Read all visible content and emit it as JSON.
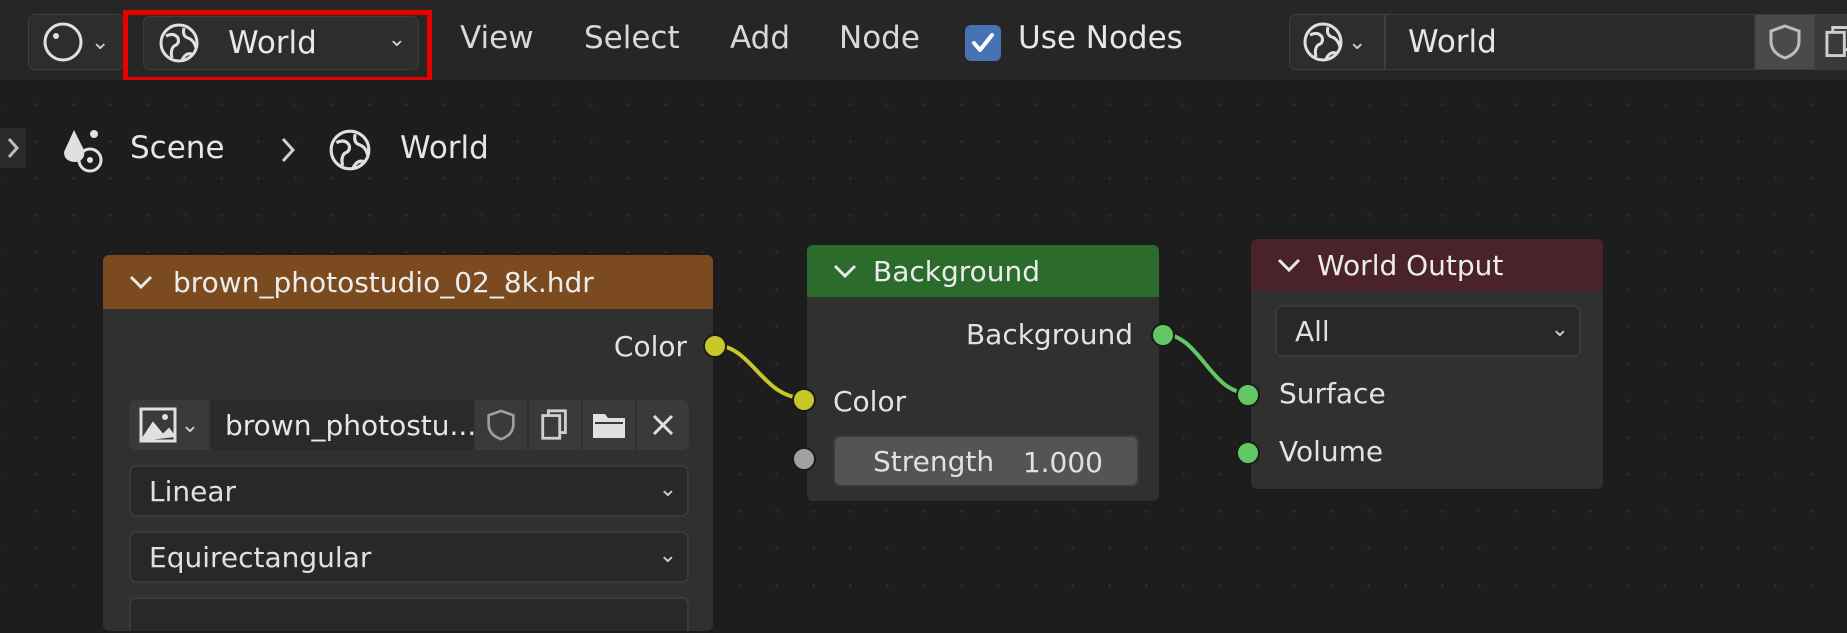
{
  "header": {
    "world_selector": {
      "label": "World"
    },
    "menus": {
      "view": "View",
      "select": "Select",
      "add": "Add",
      "node": "Node"
    },
    "use_nodes": {
      "label": "Use Nodes",
      "checked": true
    },
    "datablock": {
      "value": "World"
    }
  },
  "breadcrumb": {
    "scene": "Scene",
    "world": "World"
  },
  "nodes": {
    "image": {
      "title": "brown_photostudio_02_8k.hdr",
      "output_color": "Color",
      "image_name": "brown_photostu...",
      "interpolation": "Linear",
      "projection": "Equirectangular",
      "header_color": "#7b4a1e"
    },
    "background": {
      "title": "Background",
      "output": "Background",
      "input_color": "Color",
      "strength_label": "Strength",
      "strength_value": "1.000",
      "header_color": "#2b6b2b"
    },
    "output": {
      "title": "World Output",
      "target": "All",
      "surface": "Surface",
      "volume": "Volume",
      "header_color": "#4a2229"
    }
  },
  "colors": {
    "highlight": "#e60000",
    "socket_color": "#c7c729",
    "socket_shader": "#63c763",
    "socket_value": "#a1a1a1",
    "checkbox": "#4772b3"
  }
}
